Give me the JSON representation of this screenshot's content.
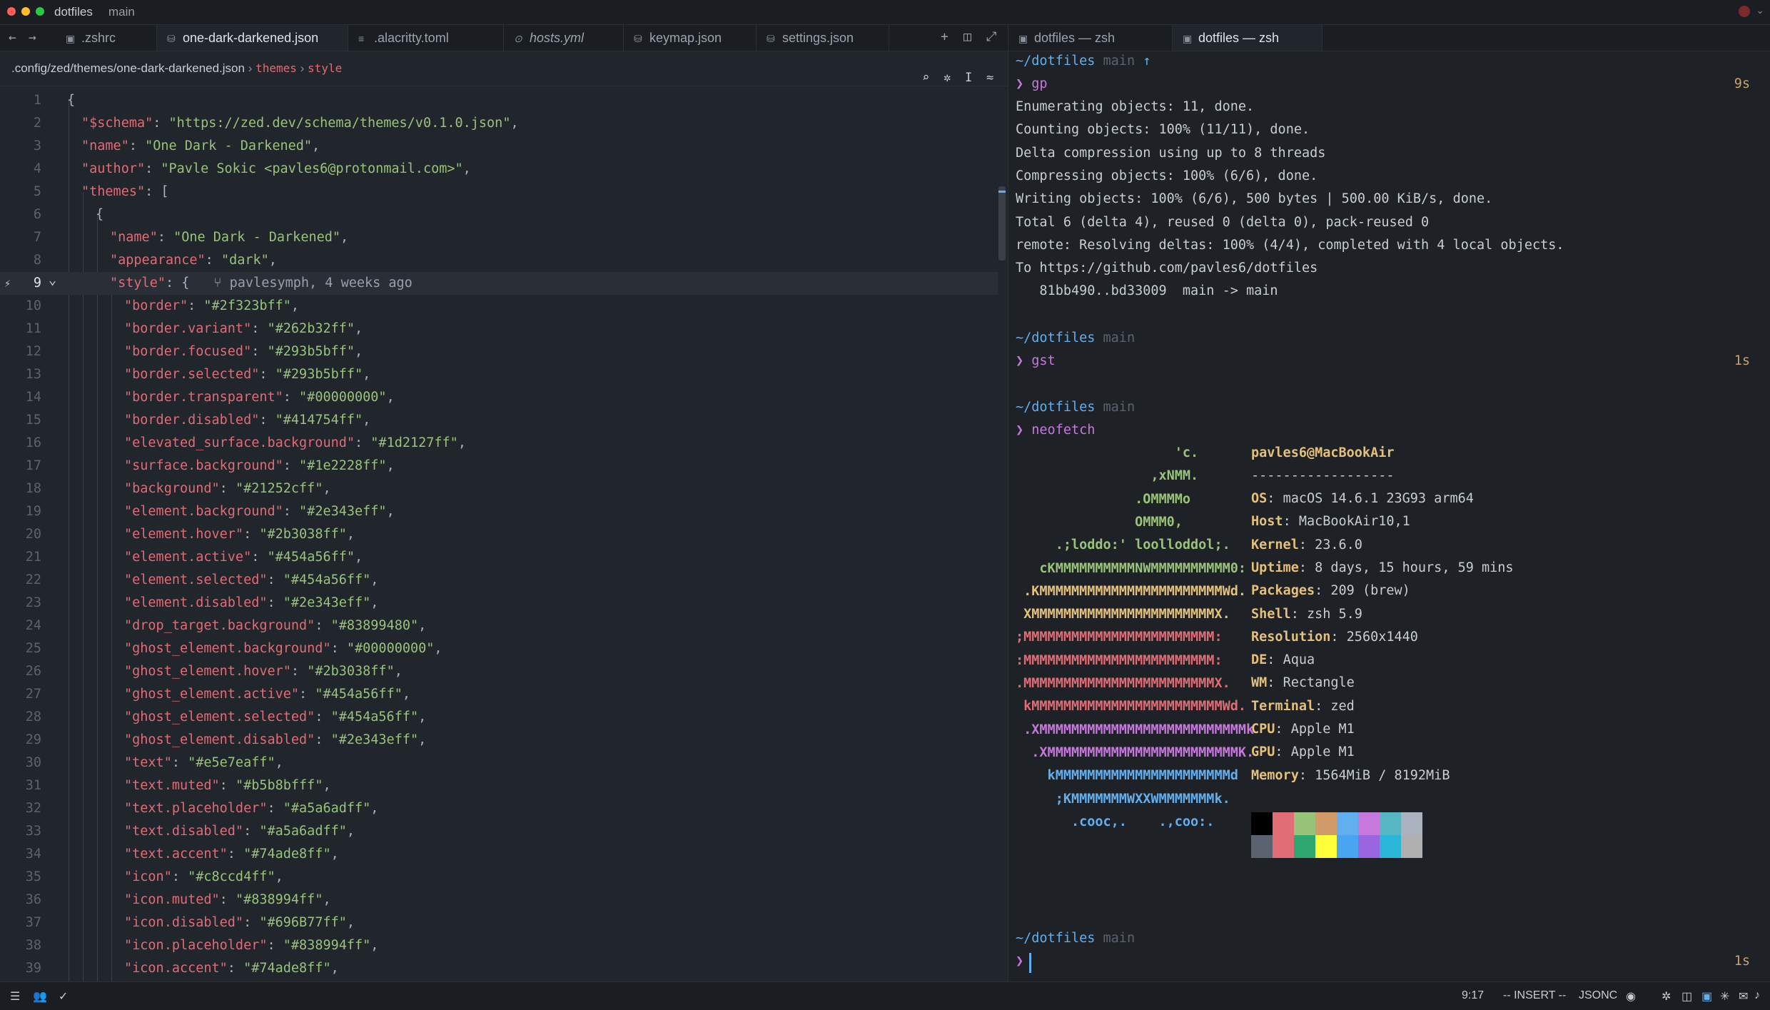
{
  "titlebar": {
    "project": "dotfiles",
    "branch": "main"
  },
  "editor_tabs": [
    {
      "label": ".zshrc",
      "icon": "terminal-icon"
    },
    {
      "label": "one-dark-darkened.json",
      "icon": "json-icon",
      "active": true
    },
    {
      "label": ".alacritty.toml",
      "icon": "toml-icon"
    },
    {
      "label": "hosts.yml",
      "icon": "yaml-icon"
    },
    {
      "label": "keymap.json",
      "icon": "json-icon"
    },
    {
      "label": "settings.json",
      "icon": "json-icon"
    }
  ],
  "terminal_tabs": [
    {
      "label": "dotfiles — zsh"
    },
    {
      "label": "dotfiles — zsh",
      "active": true
    }
  ],
  "breadcrumb": {
    "path": ".config/zed/themes/one-dark-darkened.json",
    "sep1": "›",
    "seg1": "themes",
    "sep2": "›",
    "seg2": "style"
  },
  "editor": {
    "blame": "pavlesymph, 4 weeks ago",
    "lines": [
      {
        "n": "1",
        "c": [
          [
            "p",
            "{"
          ]
        ]
      },
      {
        "n": "2",
        "c": [
          [
            "k",
            "\"$schema\""
          ],
          [
            "p",
            ": "
          ],
          [
            "s",
            "\"https://zed.dev/schema/themes/v0.1.0.json\""
          ],
          [
            "p",
            ","
          ]
        ]
      },
      {
        "n": "3",
        "c": [
          [
            "k",
            "\"name\""
          ],
          [
            "p",
            ": "
          ],
          [
            "s",
            "\"One Dark - Darkened\""
          ],
          [
            "p",
            ","
          ]
        ]
      },
      {
        "n": "4",
        "c": [
          [
            "k",
            "\"author\""
          ],
          [
            "p",
            ": "
          ],
          [
            "s",
            "\"Pavle Sokic <pavles6@protonmail.com>\""
          ],
          [
            "p",
            ","
          ]
        ]
      },
      {
        "n": "5",
        "c": [
          [
            "k",
            "\"themes\""
          ],
          [
            "p",
            ": ["
          ]
        ]
      },
      {
        "n": "6",
        "c": [
          [
            "p",
            "{"
          ]
        ]
      },
      {
        "n": "7",
        "c": [
          [
            "k",
            "\"name\""
          ],
          [
            "p",
            ": "
          ],
          [
            "s",
            "\"One Dark - Darkened\""
          ],
          [
            "p",
            ","
          ]
        ]
      },
      {
        "n": "8",
        "c": [
          [
            "k",
            "\"appearance\""
          ],
          [
            "p",
            ": "
          ],
          [
            "s",
            "\"dark\""
          ],
          [
            "p",
            ","
          ]
        ]
      },
      {
        "n": "9",
        "c": [
          [
            "k",
            "\"style\""
          ],
          [
            "p",
            ": {"
          ]
        ]
      },
      {
        "n": "10",
        "c": [
          [
            "k",
            "\"border\""
          ],
          [
            "p",
            ": "
          ],
          [
            "s",
            "\"#2f323bff\""
          ],
          [
            "p",
            ","
          ]
        ]
      },
      {
        "n": "11",
        "c": [
          [
            "k",
            "\"border.variant\""
          ],
          [
            "p",
            ": "
          ],
          [
            "s",
            "\"#262b32ff\""
          ],
          [
            "p",
            ","
          ]
        ]
      },
      {
        "n": "12",
        "c": [
          [
            "k",
            "\"border.focused\""
          ],
          [
            "p",
            ": "
          ],
          [
            "s",
            "\"#293b5bff\""
          ],
          [
            "p",
            ","
          ]
        ]
      },
      {
        "n": "13",
        "c": [
          [
            "k",
            "\"border.selected\""
          ],
          [
            "p",
            ": "
          ],
          [
            "s",
            "\"#293b5bff\""
          ],
          [
            "p",
            ","
          ]
        ]
      },
      {
        "n": "14",
        "c": [
          [
            "k",
            "\"border.transparent\""
          ],
          [
            "p",
            ": "
          ],
          [
            "s",
            "\"#00000000\""
          ],
          [
            "p",
            ","
          ]
        ]
      },
      {
        "n": "15",
        "c": [
          [
            "k",
            "\"border.disabled\""
          ],
          [
            "p",
            ": "
          ],
          [
            "s",
            "\"#414754ff\""
          ],
          [
            "p",
            ","
          ]
        ]
      },
      {
        "n": "16",
        "c": [
          [
            "k",
            "\"elevated_surface.background\""
          ],
          [
            "p",
            ": "
          ],
          [
            "s",
            "\"#1d2127ff\""
          ],
          [
            "p",
            ","
          ]
        ]
      },
      {
        "n": "17",
        "c": [
          [
            "k",
            "\"surface.background\""
          ],
          [
            "p",
            ": "
          ],
          [
            "s",
            "\"#1e2228ff\""
          ],
          [
            "p",
            ","
          ]
        ]
      },
      {
        "n": "18",
        "c": [
          [
            "k",
            "\"background\""
          ],
          [
            "p",
            ": "
          ],
          [
            "s",
            "\"#21252cff\""
          ],
          [
            "p",
            ","
          ]
        ]
      },
      {
        "n": "19",
        "c": [
          [
            "k",
            "\"element.background\""
          ],
          [
            "p",
            ": "
          ],
          [
            "s",
            "\"#2e343eff\""
          ],
          [
            "p",
            ","
          ]
        ]
      },
      {
        "n": "20",
        "c": [
          [
            "k",
            "\"element.hover\""
          ],
          [
            "p",
            ": "
          ],
          [
            "s",
            "\"#2b3038ff\""
          ],
          [
            "p",
            ","
          ]
        ]
      },
      {
        "n": "21",
        "c": [
          [
            "k",
            "\"element.active\""
          ],
          [
            "p",
            ": "
          ],
          [
            "s",
            "\"#454a56ff\""
          ],
          [
            "p",
            ","
          ]
        ]
      },
      {
        "n": "22",
        "c": [
          [
            "k",
            "\"element.selected\""
          ],
          [
            "p",
            ": "
          ],
          [
            "s",
            "\"#454a56ff\""
          ],
          [
            "p",
            ","
          ]
        ]
      },
      {
        "n": "23",
        "c": [
          [
            "k",
            "\"element.disabled\""
          ],
          [
            "p",
            ": "
          ],
          [
            "s",
            "\"#2e343eff\""
          ],
          [
            "p",
            ","
          ]
        ]
      },
      {
        "n": "24",
        "c": [
          [
            "k",
            "\"drop_target.background\""
          ],
          [
            "p",
            ": "
          ],
          [
            "s",
            "\"#83899480\""
          ],
          [
            "p",
            ","
          ]
        ]
      },
      {
        "n": "25",
        "c": [
          [
            "k",
            "\"ghost_element.background\""
          ],
          [
            "p",
            ": "
          ],
          [
            "s",
            "\"#00000000\""
          ],
          [
            "p",
            ","
          ]
        ]
      },
      {
        "n": "26",
        "c": [
          [
            "k",
            "\"ghost_element.hover\""
          ],
          [
            "p",
            ": "
          ],
          [
            "s",
            "\"#2b3038ff\""
          ],
          [
            "p",
            ","
          ]
        ]
      },
      {
        "n": "27",
        "c": [
          [
            "k",
            "\"ghost_element.active\""
          ],
          [
            "p",
            ": "
          ],
          [
            "s",
            "\"#454a56ff\""
          ],
          [
            "p",
            ","
          ]
        ]
      },
      {
        "n": "28",
        "c": [
          [
            "k",
            "\"ghost_element.selected\""
          ],
          [
            "p",
            ": "
          ],
          [
            "s",
            "\"#454a56ff\""
          ],
          [
            "p",
            ","
          ]
        ]
      },
      {
        "n": "29",
        "c": [
          [
            "k",
            "\"ghost_element.disabled\""
          ],
          [
            "p",
            ": "
          ],
          [
            "s",
            "\"#2e343eff\""
          ],
          [
            "p",
            ","
          ]
        ]
      },
      {
        "n": "30",
        "c": [
          [
            "k",
            "\"text\""
          ],
          [
            "p",
            ": "
          ],
          [
            "s",
            "\"#e5e7eaff\""
          ],
          [
            "p",
            ","
          ]
        ]
      },
      {
        "n": "31",
        "c": [
          [
            "k",
            "\"text.muted\""
          ],
          [
            "p",
            ": "
          ],
          [
            "s",
            "\"#b5b8bfff\""
          ],
          [
            "p",
            ","
          ]
        ]
      },
      {
        "n": "32",
        "c": [
          [
            "k",
            "\"text.placeholder\""
          ],
          [
            "p",
            ": "
          ],
          [
            "s",
            "\"#a5a6adff\""
          ],
          [
            "p",
            ","
          ]
        ]
      },
      {
        "n": "33",
        "c": [
          [
            "k",
            "\"text.disabled\""
          ],
          [
            "p",
            ": "
          ],
          [
            "s",
            "\"#a5a6adff\""
          ],
          [
            "p",
            ","
          ]
        ]
      },
      {
        "n": "34",
        "c": [
          [
            "k",
            "\"text.accent\""
          ],
          [
            "p",
            ": "
          ],
          [
            "s",
            "\"#74ade8ff\""
          ],
          [
            "p",
            ","
          ]
        ]
      },
      {
        "n": "35",
        "c": [
          [
            "k",
            "\"icon\""
          ],
          [
            "p",
            ": "
          ],
          [
            "s",
            "\"#c8ccd4ff\""
          ],
          [
            "p",
            ","
          ]
        ]
      },
      {
        "n": "36",
        "c": [
          [
            "k",
            "\"icon.muted\""
          ],
          [
            "p",
            ": "
          ],
          [
            "s",
            "\"#838994ff\""
          ],
          [
            "p",
            ","
          ]
        ]
      },
      {
        "n": "37",
        "c": [
          [
            "k",
            "\"icon.disabled\""
          ],
          [
            "p",
            ": "
          ],
          [
            "s",
            "\"#696B77ff\""
          ],
          [
            "p",
            ","
          ]
        ]
      },
      {
        "n": "38",
        "c": [
          [
            "k",
            "\"icon.placeholder\""
          ],
          [
            "p",
            ": "
          ],
          [
            "s",
            "\"#838994ff\""
          ],
          [
            "p",
            ","
          ]
        ]
      },
      {
        "n": "39",
        "c": [
          [
            "k",
            "\"icon.accent\""
          ],
          [
            "p",
            ": "
          ],
          [
            "s",
            "\"#74ade8ff\""
          ],
          [
            "p",
            ","
          ]
        ]
      }
    ]
  },
  "terminal": {
    "prompt_dir": "~/dotfiles",
    "prompt_branch": "main",
    "prompt_ahead": "↑",
    "prompt_char": "❯",
    "cmd1": "gp",
    "dur1": "9s",
    "output1": [
      "Enumerating objects: 11, done.",
      "Counting objects: 100% (11/11), done.",
      "Delta compression using up to 8 threads",
      "Compressing objects: 100% (6/6), done.",
      "Writing objects: 100% (6/6), 500 bytes | 500.00 KiB/s, done.",
      "Total 6 (delta 4), reused 0 (delta 0), pack-reused 0",
      "remote: Resolving deltas: 100% (4/4), completed with 4 local objects.",
      "To https://github.com/pavles6/dotfiles",
      "   81bb490..bd33009  main -> main"
    ],
    "cmd2": "gst",
    "dur2": "1s",
    "cmd3": "neofetch",
    "dur4": "1s",
    "neofetch_logo": [
      "                    'c.",
      "                 ,xNMM.",
      "               .OMMMMo",
      "               OMMM0,",
      "     .;loddo:' loolloddol;.",
      "   cKMMMMMMMMMMNWMMMMMMMMMM0:",
      " .KMMMMMMMMMMMMMMMMMMMMMMMWd.",
      " XMMMMMMMMMMMMMMMMMMMMMMMX.",
      ";MMMMMMMMMMMMMMMMMMMMMMMM:",
      ":MMMMMMMMMMMMMMMMMMMMMMMM:",
      ".MMMMMMMMMMMMMMMMMMMMMMMMX.",
      " kMMMMMMMMMMMMMMMMMMMMMMMMWd.",
      " .XMMMMMMMMMMMMMMMMMMMMMMMMMMk",
      "  .XMMMMMMMMMMMMMMMMMMMMMMMMK.",
      "    kMMMMMMMMMMMMMMMMMMMMMMd",
      "     ;KMMMMMMMWXXWMMMMMMMk.",
      "       .cooc,.    .,coo:."
    ],
    "neofetch_user": "pavles6@MacBookAir",
    "neofetch_sep": "------------------",
    "neofetch_info": [
      {
        "k": "OS",
        "v": "macOS 14.6.1 23G93 arm64"
      },
      {
        "k": "Host",
        "v": "MacBookAir10,1"
      },
      {
        "k": "Kernel",
        "v": "23.6.0"
      },
      {
        "k": "Uptime",
        "v": "8 days, 15 hours, 59 mins"
      },
      {
        "k": "Packages",
        "v": "209 (brew)"
      },
      {
        "k": "Shell",
        "v": "zsh 5.9"
      },
      {
        "k": "Resolution",
        "v": "2560x1440"
      },
      {
        "k": "DE",
        "v": "Aqua"
      },
      {
        "k": "WM",
        "v": "Rectangle"
      },
      {
        "k": "Terminal",
        "v": "zed"
      },
      {
        "k": "CPU",
        "v": "Apple M1"
      },
      {
        "k": "GPU",
        "v": "Apple M1"
      },
      {
        "k": "Memory",
        "v": "1564MiB / 8192MiB"
      }
    ],
    "palette_top": [
      "#000000",
      "#e06c75",
      "#98c379",
      "#d19a66",
      "#61afef",
      "#c678dd",
      "#56b6c2",
      "#abb2bf"
    ],
    "palette_bottom": [
      "#5c6370",
      "#e06c75",
      "#2fa86f",
      "#ffff3a",
      "#4aa5f0",
      "#9966e0",
      "#2ab6d9",
      "#b0b0b0"
    ]
  },
  "statusbar": {
    "position": "9:17",
    "mode": "-- INSERT --",
    "language": "JSONC"
  }
}
